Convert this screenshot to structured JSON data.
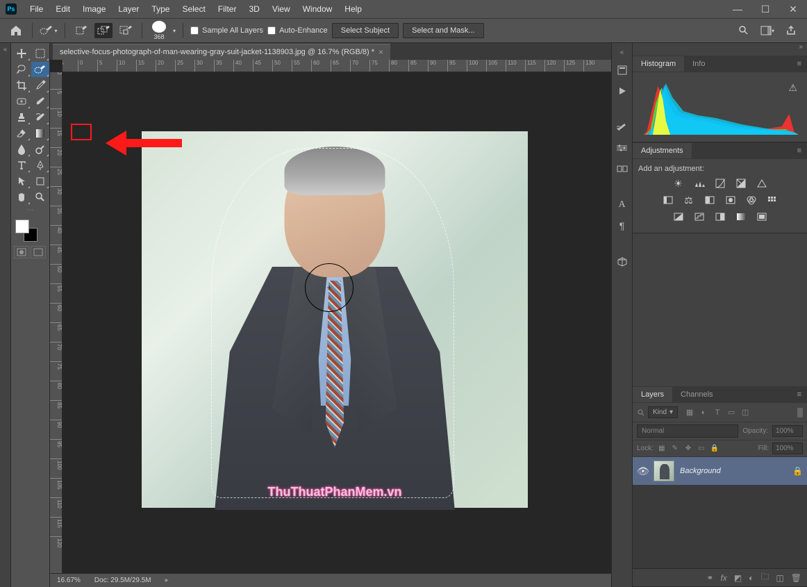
{
  "app": {
    "logo_text": "Ps"
  },
  "menubar": [
    "File",
    "Edit",
    "Image",
    "Layer",
    "Type",
    "Select",
    "Filter",
    "3D",
    "View",
    "Window",
    "Help"
  ],
  "window_controls": {
    "min": "—",
    "max": "☐",
    "close": "✕"
  },
  "optionbar": {
    "brush_size": "368",
    "sample_all_layers": "Sample All Layers",
    "auto_enhance": "Auto-Enhance",
    "select_subject": "Select Subject",
    "select_and_mask": "Select and Mask..."
  },
  "document": {
    "tab_title": "selective-focus-photograph-of-man-wearing-gray-suit-jacket-1138903.jpg @ 16.7% (RGB/8) *",
    "zoom": "16.67%",
    "doc_size": "Doc: 29.5M/29.5M",
    "watermark": "ThuThuatPhanMem.vn"
  },
  "ruler_h": [
    "5",
    "0",
    "5",
    "10",
    "15",
    "20",
    "25",
    "30",
    "35",
    "40",
    "45",
    "50",
    "55",
    "60",
    "65",
    "70",
    "75",
    "80",
    "85",
    "90",
    "95",
    "100",
    "105",
    "110",
    "115",
    "120",
    "125",
    "130"
  ],
  "ruler_v": [
    "0",
    "5",
    "10",
    "15",
    "20",
    "25",
    "30",
    "35",
    "40",
    "45",
    "50",
    "55",
    "60",
    "65",
    "70",
    "75",
    "80",
    "85",
    "90",
    "95",
    "100",
    "105",
    "110",
    "115",
    "120"
  ],
  "panels": {
    "histogram_tab": "Histogram",
    "info_tab": "Info",
    "adjustments_tab": "Adjustments",
    "adjustments_label": "Add an adjustment:",
    "layers_tab": "Layers",
    "channels_tab": "Channels",
    "kind_label": "Kind",
    "blend_mode": "Normal",
    "opacity_label": "Opacity:",
    "opacity_value": "100%",
    "lock_label": "Lock:",
    "fill_label": "Fill:",
    "fill_value": "100%",
    "layer_name": "Background"
  }
}
